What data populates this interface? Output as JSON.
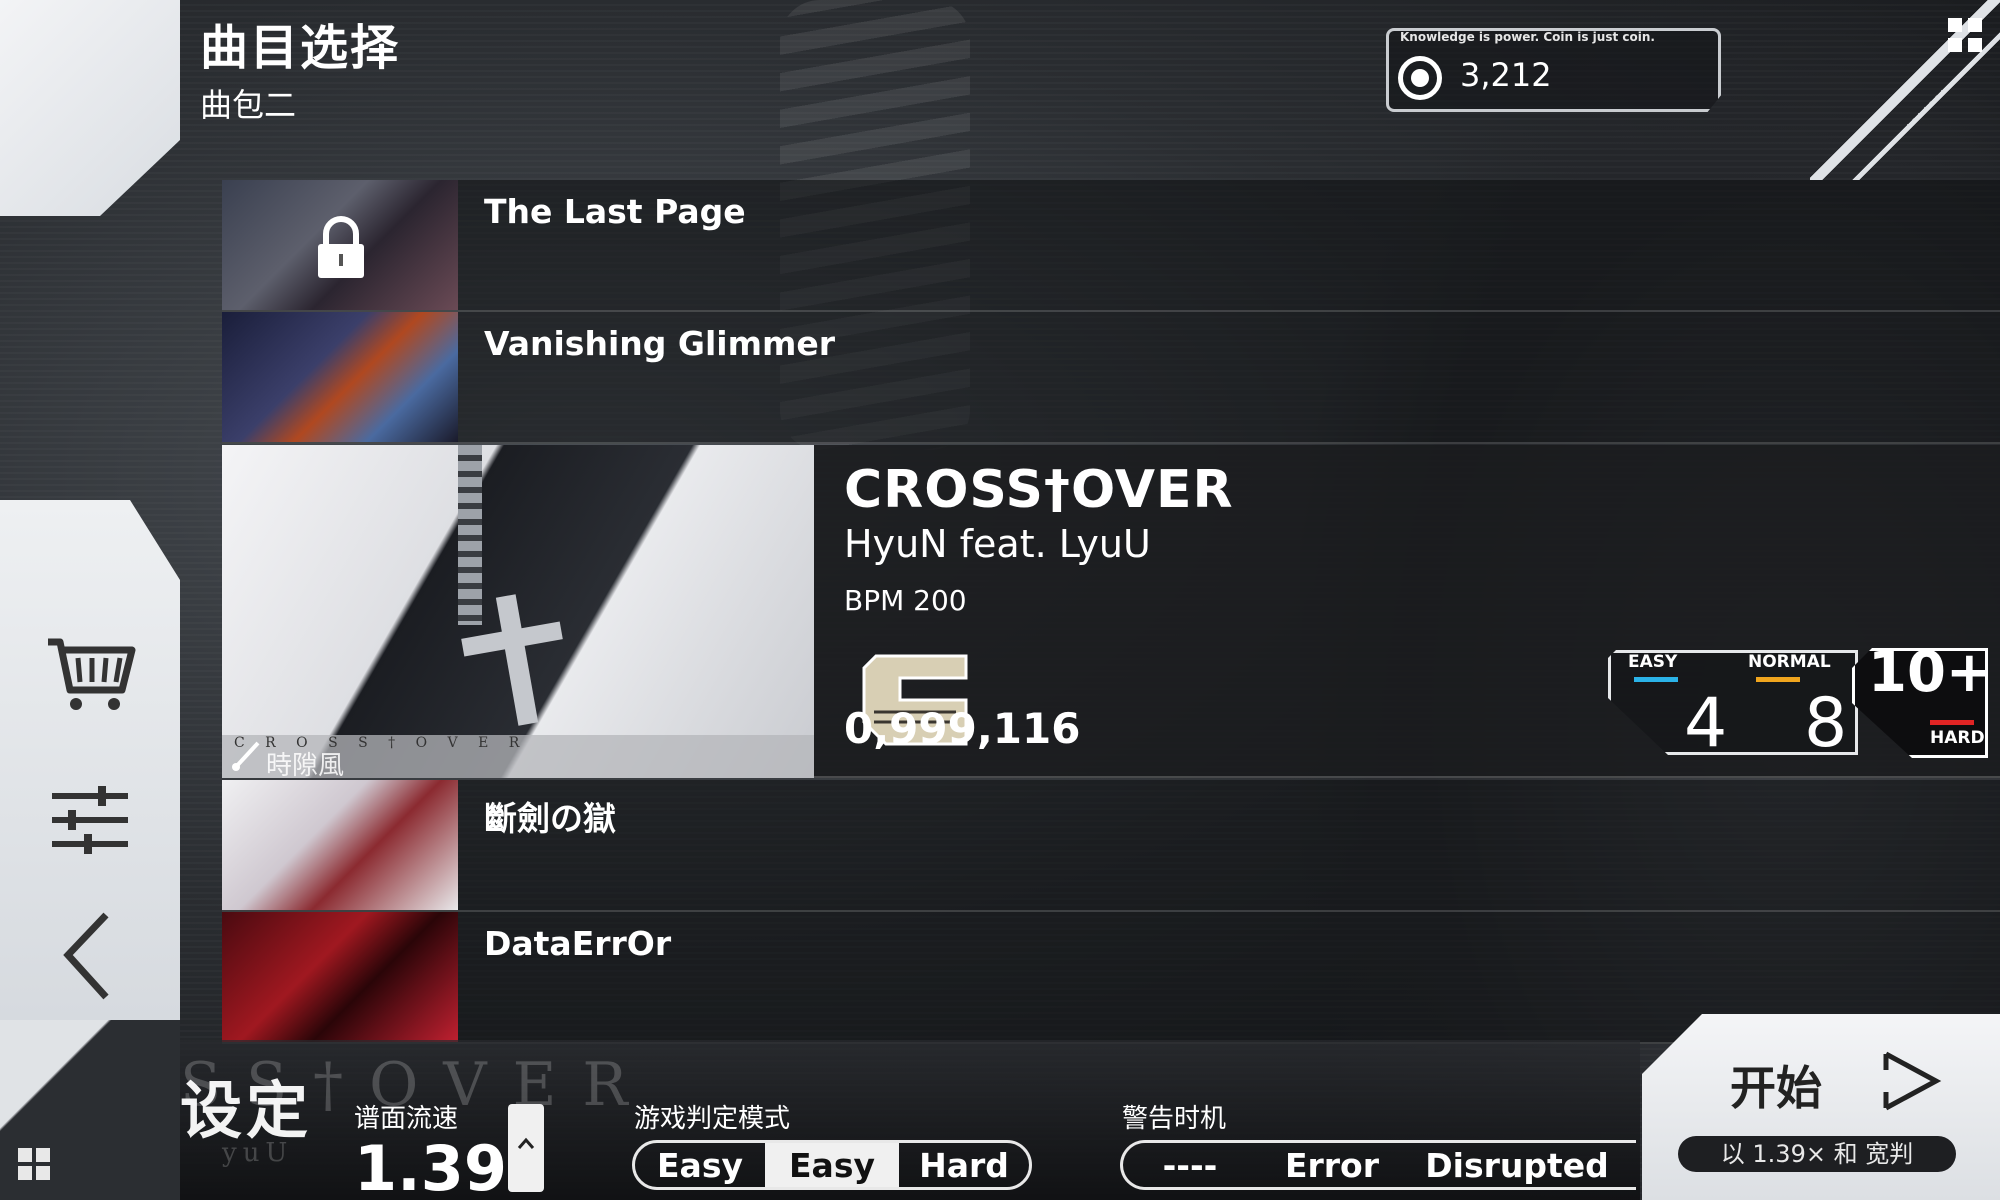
{
  "header": {
    "title": "曲目选择",
    "subtitle": "曲包二"
  },
  "coins": {
    "caption": "Knowledge is power. Coin is just coin.",
    "value": "3,212"
  },
  "songs": [
    {
      "name": "The Last Page",
      "locked": true
    },
    {
      "name": "Vanishing Glimmer",
      "locked": false
    },
    {
      "name": "斷劍の獄",
      "locked": false
    },
    {
      "name": "DataErrOr",
      "locked": false
    }
  ],
  "selected": {
    "title": "CROSS†OVER",
    "artist": "HyuN feat. LyuU",
    "bpm": "BPM 200",
    "score": "0,999,116",
    "illustrator": "時隙風",
    "art_logo": "C R O S S † O V E R",
    "difficulties": [
      {
        "label": "EASY",
        "level": "4",
        "color": "#2bb3e8"
      },
      {
        "label": "NORMAL",
        "level": "8",
        "color": "#f0a51e"
      },
      {
        "label": "HARD",
        "level": "10+",
        "color": "#e02424"
      }
    ]
  },
  "settings": {
    "heading": "设定",
    "watermark": "SS†OVER",
    "watermark_sub": "yuU",
    "speed_label": "谱面流速",
    "speed_value": "1.39",
    "judge_label": "游戏判定模式",
    "judge_options": [
      "Easy",
      "Easy",
      "Hard"
    ],
    "judge_selected": 1,
    "warn_label": "警告时机",
    "warn_options": [
      "----",
      "Error",
      "Disrupted"
    ]
  },
  "start": {
    "label": "开始",
    "sub": "以 1.39× 和 宽判"
  }
}
